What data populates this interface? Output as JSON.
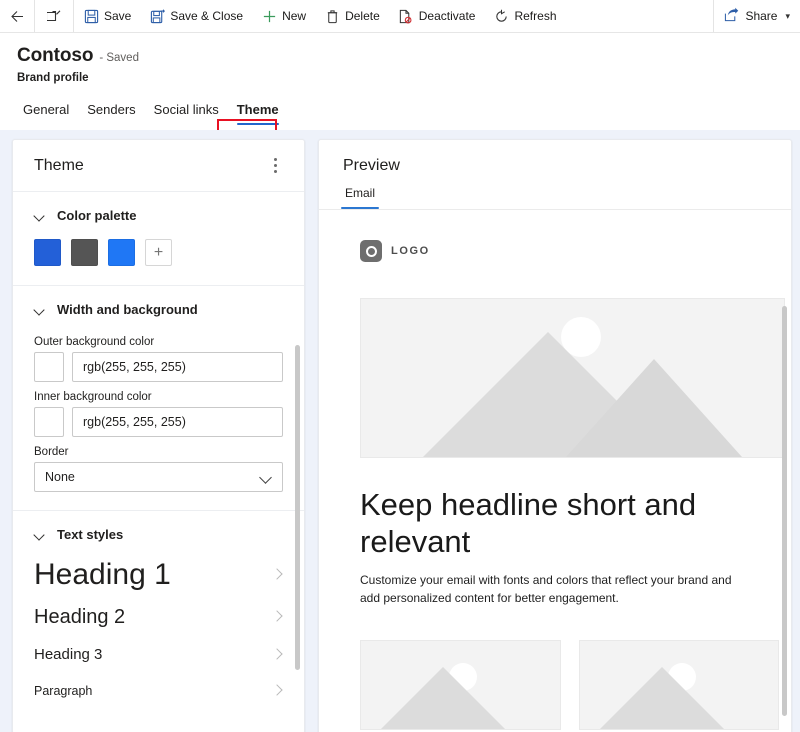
{
  "command_bar": {
    "back": {
      "label": "",
      "icon": "back-arrow-icon"
    },
    "popout": {
      "label": "",
      "icon": "popout-icon"
    },
    "buttons": [
      {
        "label": "Save",
        "icon": "save-icon"
      },
      {
        "label": "Save & Close",
        "icon": "save-and-close-icon"
      },
      {
        "label": "New",
        "icon": "plus-icon"
      },
      {
        "label": "Delete",
        "icon": "trash-icon"
      },
      {
        "label": "Deactivate",
        "icon": "deactivate-icon"
      },
      {
        "label": "Refresh",
        "icon": "refresh-icon"
      }
    ],
    "share": {
      "label": "Share",
      "icon": "share-icon",
      "chevron": "chevron-down-icon"
    }
  },
  "header": {
    "title": "Contoso",
    "saved_state": "- Saved",
    "subtitle": "Brand profile",
    "tabs": [
      {
        "label": "General",
        "active": false
      },
      {
        "label": "Senders",
        "active": false
      },
      {
        "label": "Social links",
        "active": false
      },
      {
        "label": "Theme",
        "active": true
      }
    ],
    "highlight_color": "#e81123"
  },
  "theme_panel": {
    "title": "Theme",
    "more_options": "more-options",
    "color_palette": {
      "title": "Color palette",
      "swatches": [
        {
          "name": "palette-swatch-1",
          "color": "#2360d8"
        },
        {
          "name": "palette-swatch-2",
          "color": "#555555"
        },
        {
          "name": "palette-swatch-3",
          "color": "#1f77f5"
        }
      ],
      "add_label": "+"
    },
    "width_background": {
      "title": "Width and background",
      "fields": [
        {
          "label": "Outer background color",
          "value": "rgb(255, 255, 255)",
          "swatch": "#ffffff"
        },
        {
          "label": "Inner background color",
          "value": "rgb(255, 255, 255)",
          "swatch": "#ffffff"
        }
      ],
      "border": {
        "label": "Border",
        "value": "None"
      }
    },
    "text_styles": {
      "title": "Text styles",
      "items": [
        {
          "label": "Heading 1"
        },
        {
          "label": "Heading 2"
        },
        {
          "label": "Heading 3"
        },
        {
          "label": "Paragraph"
        }
      ]
    }
  },
  "preview_panel": {
    "title": "Preview",
    "tabs": [
      {
        "label": "Email",
        "active": true
      }
    ],
    "email": {
      "logo_text": "LOGO",
      "hero_image_alt": "hero-image-placeholder",
      "headline": "Keep headline short and relevant",
      "body": "Customize your email with fonts and colors that reflect your brand and add personalized content for better engagement.",
      "cards": [
        {
          "alt": "card-image-placeholder-1"
        },
        {
          "alt": "card-image-placeholder-2"
        }
      ]
    }
  },
  "colors": {
    "accent_blue": "#2b77d1",
    "workspace_bg": "#eef2fa",
    "panel_bg": "#ffffff"
  }
}
